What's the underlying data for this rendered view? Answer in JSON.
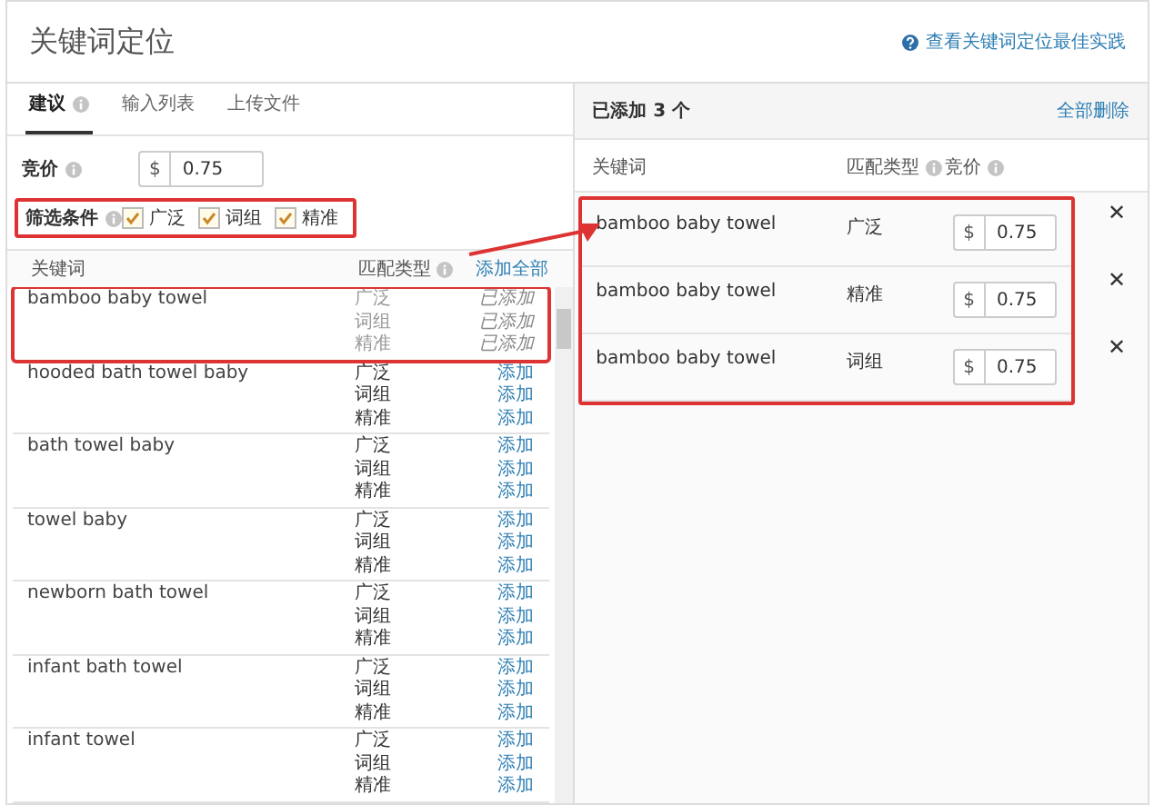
{
  "header": {
    "title": "关键词定位",
    "help_link": "查看关键词定位最佳实践"
  },
  "tabs": [
    {
      "label": "建议",
      "selected": true,
      "info": true
    },
    {
      "label": "输入列表",
      "selected": false,
      "info": false
    },
    {
      "label": "上传文件",
      "selected": false,
      "info": false
    }
  ],
  "bid": {
    "label": "竞价",
    "currency": "$",
    "value": "0.75"
  },
  "filters": {
    "label": "筛选条件",
    "highlighted": true,
    "options": [
      {
        "label": "广泛",
        "checked": true
      },
      {
        "label": "词组",
        "checked": true
      },
      {
        "label": "精准",
        "checked": true
      }
    ]
  },
  "suggestions": {
    "columns": [
      "关键词",
      "匹配类型"
    ],
    "add_all": "添加全部",
    "rows": [
      {
        "keyword": "bamboo baby towel",
        "highlighted": true,
        "matches": [
          {
            "type": "广泛",
            "action": "已添加",
            "added": true
          },
          {
            "type": "词组",
            "action": "已添加",
            "added": true
          },
          {
            "type": "精准",
            "action": "已添加",
            "added": true
          }
        ]
      },
      {
        "keyword": "hooded bath towel baby",
        "highlighted": false,
        "matches": [
          {
            "type": "广泛",
            "action": "添加",
            "added": false
          },
          {
            "type": "词组",
            "action": "添加",
            "added": false
          },
          {
            "type": "精准",
            "action": "添加",
            "added": false
          }
        ]
      },
      {
        "keyword": "bath towel baby",
        "highlighted": false,
        "matches": [
          {
            "type": "广泛",
            "action": "添加",
            "added": false
          },
          {
            "type": "词组",
            "action": "添加",
            "added": false
          },
          {
            "type": "精准",
            "action": "添加",
            "added": false
          }
        ]
      },
      {
        "keyword": "towel baby",
        "highlighted": false,
        "matches": [
          {
            "type": "广泛",
            "action": "添加",
            "added": false
          },
          {
            "type": "词组",
            "action": "添加",
            "added": false
          },
          {
            "type": "精准",
            "action": "添加",
            "added": false
          }
        ]
      },
      {
        "keyword": "newborn bath towel",
        "highlighted": false,
        "matches": [
          {
            "type": "广泛",
            "action": "添加",
            "added": false
          },
          {
            "type": "词组",
            "action": "添加",
            "added": false
          },
          {
            "type": "精准",
            "action": "添加",
            "added": false
          }
        ]
      },
      {
        "keyword": "infant bath towel",
        "highlighted": false,
        "matches": [
          {
            "type": "广泛",
            "action": "添加",
            "added": false
          },
          {
            "type": "词组",
            "action": "添加",
            "added": false
          },
          {
            "type": "精准",
            "action": "添加",
            "added": false
          }
        ]
      },
      {
        "keyword": "infant towel",
        "highlighted": false,
        "matches": [
          {
            "type": "广泛",
            "action": "添加",
            "added": false
          },
          {
            "type": "词组",
            "action": "添加",
            "added": false
          },
          {
            "type": "精准",
            "action": "添加",
            "added": false
          }
        ]
      }
    ]
  },
  "added": {
    "title": "已添加 3 个",
    "remove_all": "全部删除",
    "columns": [
      "关键词",
      "匹配类型",
      "竞价"
    ],
    "highlighted": true,
    "rows": [
      {
        "keyword": "bamboo baby towel",
        "match": "广泛",
        "currency": "$",
        "bid": "0.75",
        "remove": "✕"
      },
      {
        "keyword": "bamboo baby towel",
        "match": "精准",
        "currency": "$",
        "bid": "0.75",
        "remove": "✕"
      },
      {
        "keyword": "bamboo baby towel",
        "match": "词组",
        "currency": "$",
        "bid": "0.75",
        "remove": "✕"
      }
    ]
  }
}
